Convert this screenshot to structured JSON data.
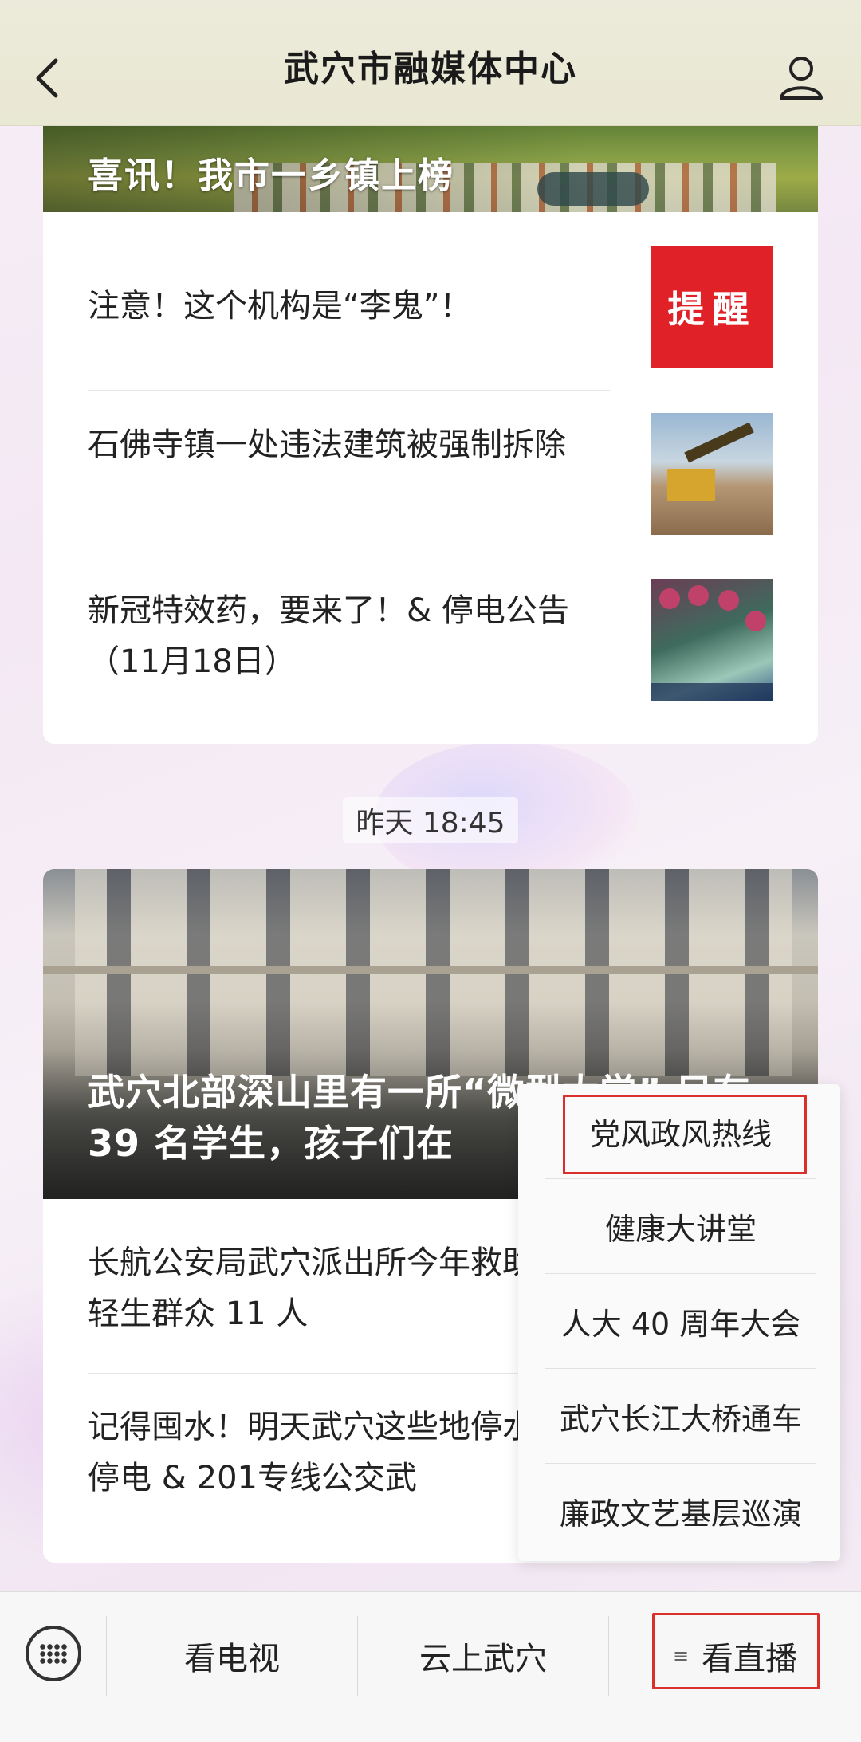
{
  "header": {
    "title": "武穴市融媒体中心"
  },
  "card1": {
    "banner_title": "喜讯！我市一乡镇上榜",
    "items": [
      {
        "text": "注意！这个机构是“李鬼”！",
        "thumb_text": "提醒"
      },
      {
        "text": "石佛寺镇一处违法建筑被强制拆除"
      },
      {
        "text": "新冠特效药，要来了！& 停电公告（11月18日）"
      }
    ]
  },
  "timestamp": "昨天 18:45",
  "card2": {
    "hero_title": "武穴北部深山里有一所“微型大学” 只有 39 名学生，孩子们在",
    "items": [
      {
        "text": "长航公安局武穴派出所今年救助轻生群众 11 人"
      },
      {
        "text": "记得囤水！明天武穴这些地停水停电 & 201专线公交武"
      }
    ]
  },
  "popup_menu": {
    "items": [
      "党风政风热线",
      "健康大讲堂",
      "人大 40 周年大会",
      "武穴长江大桥通车",
      "廉政文艺基层巡演"
    ],
    "highlighted_index": 0
  },
  "bottom_nav": {
    "items": [
      "看电视",
      "云上武穴",
      "看直播"
    ],
    "active_menu_glyph": "≡"
  },
  "colors": {
    "header_bg": "#eceada",
    "highlight_border": "#d9302c",
    "remind_red": "#e02128"
  }
}
